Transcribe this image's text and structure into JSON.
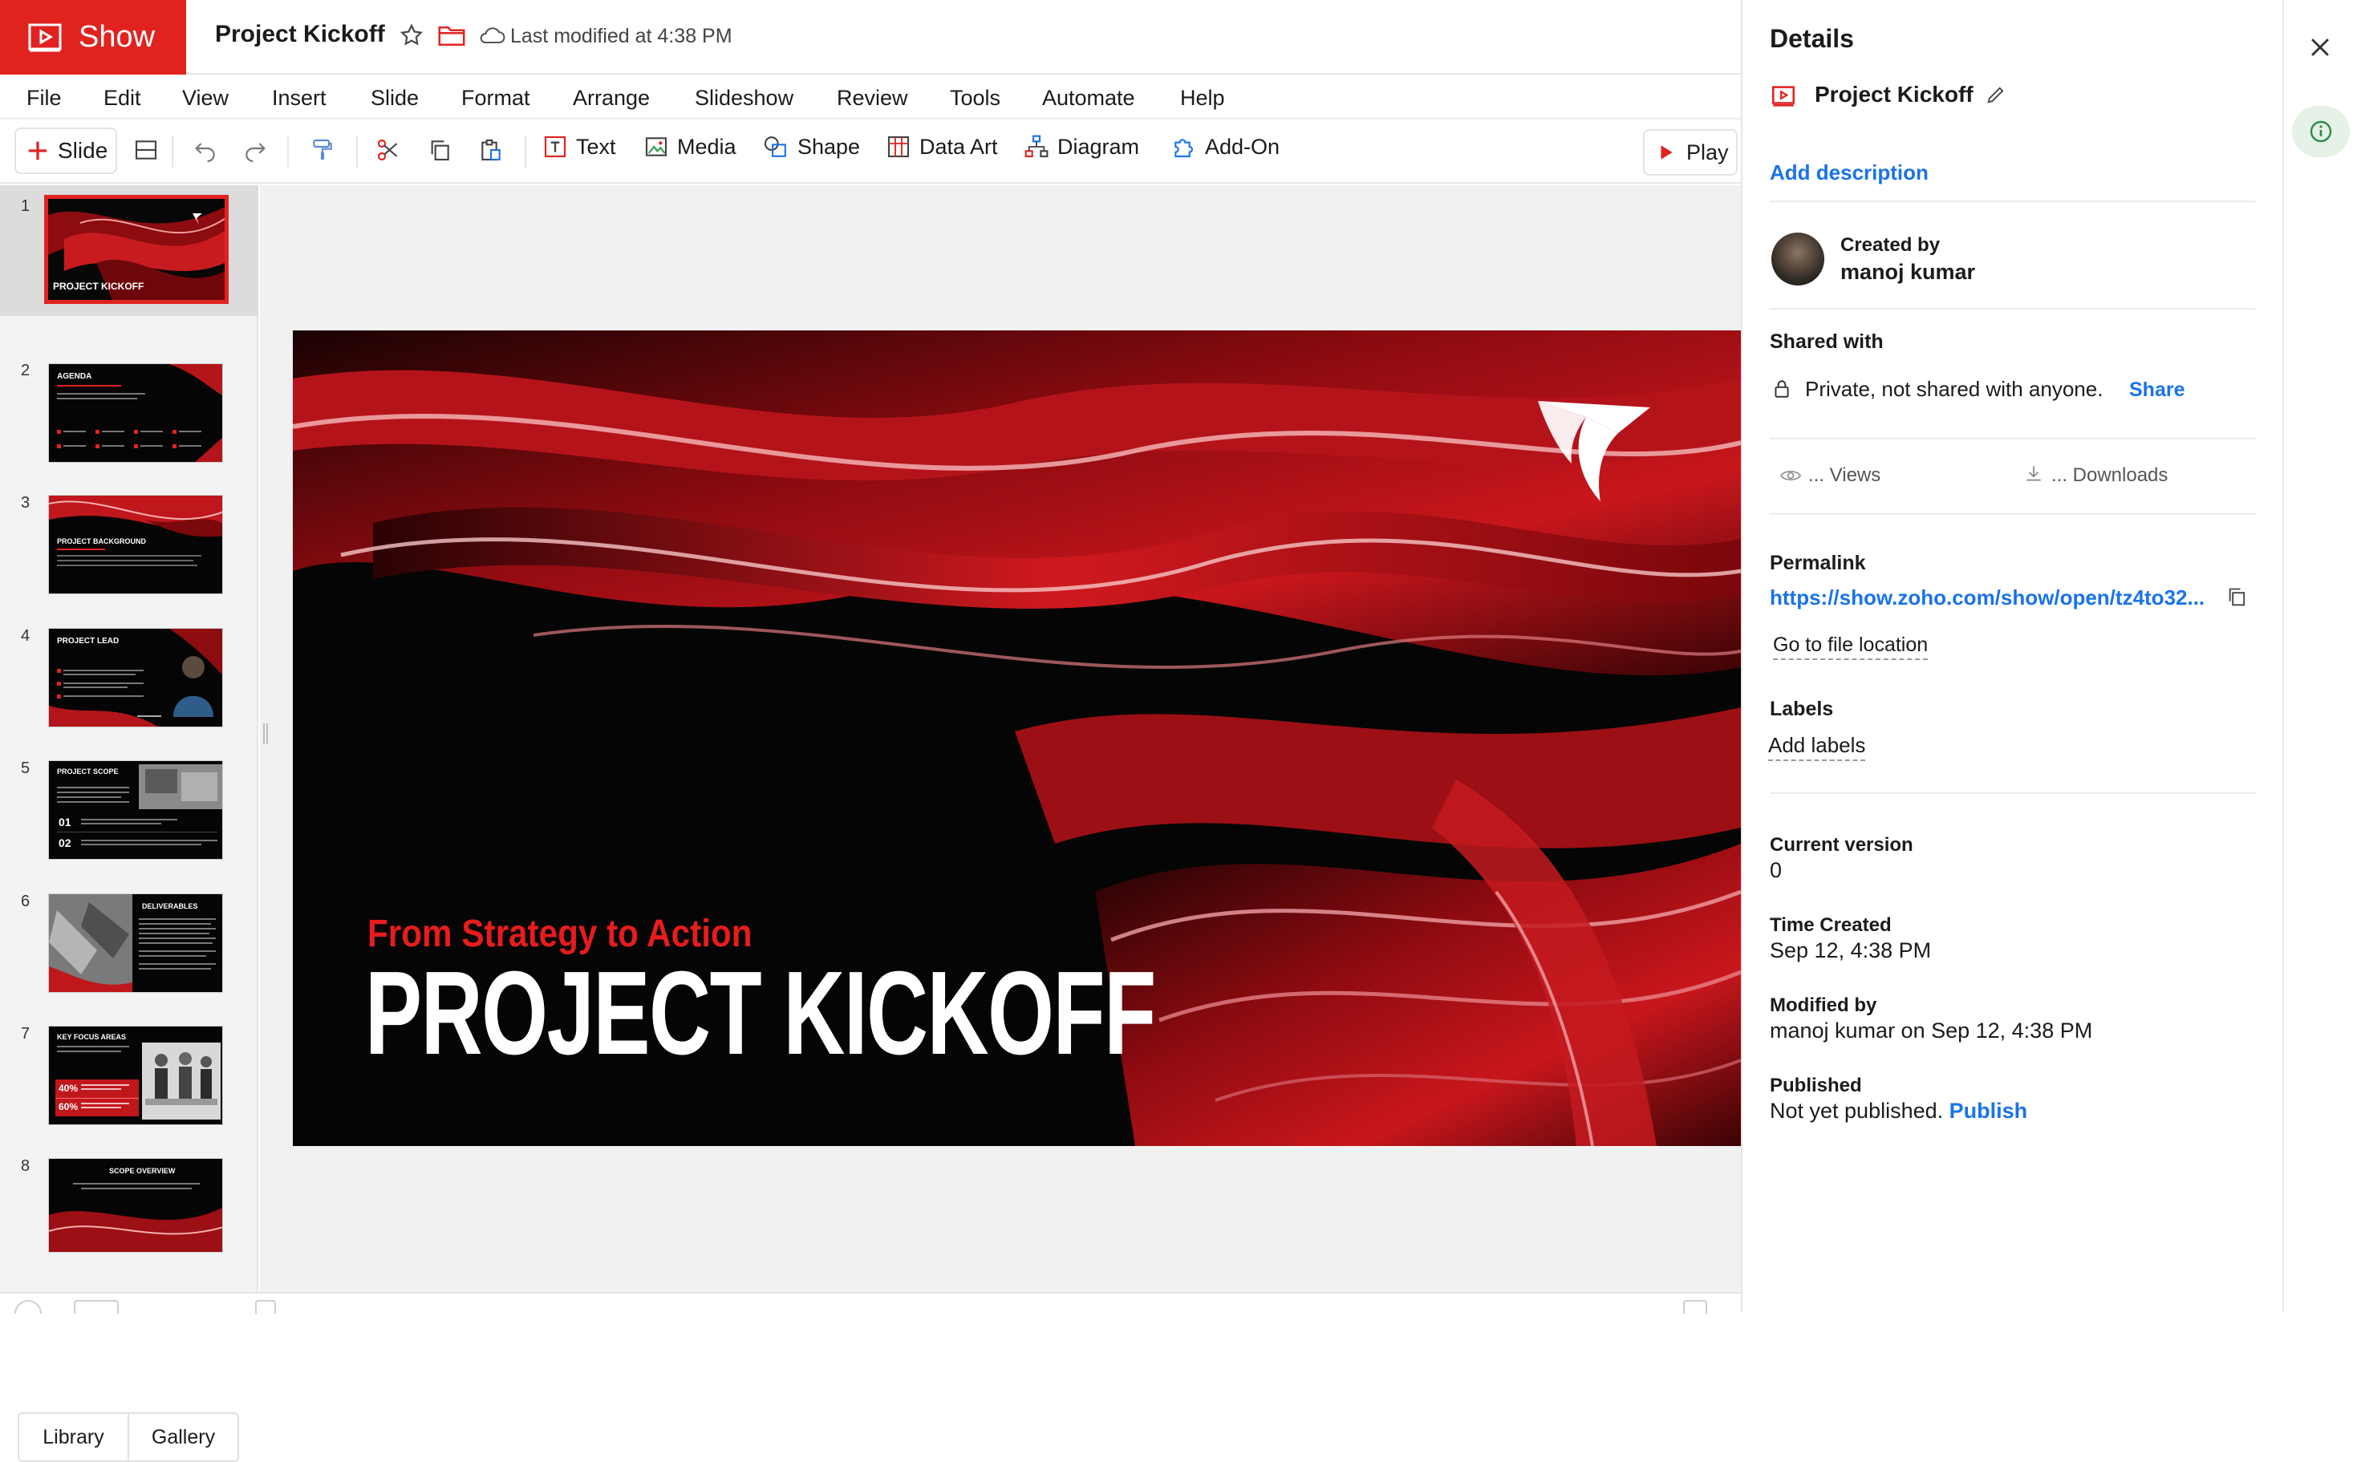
{
  "app": {
    "brand": "Show",
    "doc_title": "Project Kickoff",
    "last_modified": "Last modified at 4:38 PM"
  },
  "menu": [
    "File",
    "Edit",
    "View",
    "Insert",
    "Slide",
    "Format",
    "Arrange",
    "Slideshow",
    "Review",
    "Tools",
    "Automate",
    "Help"
  ],
  "toolbar": {
    "slide_label": "Slide",
    "text_label": "Text",
    "media_label": "Media",
    "shape_label": "Shape",
    "data_art_label": "Data Art",
    "diagram_label": "Diagram",
    "addon_label": "Add-On",
    "play_label": "Play"
  },
  "slides": [
    {
      "number": "1",
      "title": "PROJECT KICKOFF"
    },
    {
      "number": "2",
      "title": "AGENDA"
    },
    {
      "number": "3",
      "title": "PROJECT BACKGROUND"
    },
    {
      "number": "4",
      "title": "PROJECT LEAD"
    },
    {
      "number": "5",
      "title": "PROJECT SCOPE",
      "items": [
        "01",
        "02"
      ]
    },
    {
      "number": "6",
      "title": "DELIVERABLES"
    },
    {
      "number": "7",
      "title": "KEY FOCUS AREAS",
      "items": [
        "40%",
        "60%"
      ]
    },
    {
      "number": "8",
      "title": "SCOPE OVERVIEW"
    }
  ],
  "panel_tabs": {
    "library": "Library",
    "gallery": "Gallery"
  },
  "main_slide": {
    "subtitle": "From Strategy to Action",
    "title": "PROJECT KICKOFF"
  },
  "details": {
    "heading": "Details",
    "file_name": "Project Kickoff",
    "add_description": "Add description",
    "created_by_label": "Created by",
    "created_by": "manoj kumar",
    "shared_with_label": "Shared with",
    "shared_status": "Private, not shared with anyone.",
    "share_link": "Share",
    "views": "... Views",
    "downloads": "... Downloads",
    "permalink_label": "Permalink",
    "permalink": "https://show.zoho.com/show/open/tz4to32...",
    "go_to_location": "Go to file location",
    "labels_label": "Labels",
    "add_labels": "Add labels",
    "current_version_label": "Current version",
    "current_version": "0",
    "time_created_label": "Time Created",
    "time_created": "Sep 12, 4:38 PM",
    "modified_by_label": "Modified by",
    "modified_by": "manoj kumar on Sep 12, 4:38 PM",
    "published_label": "Published",
    "published_status": "Not yet published.",
    "publish_link": "Publish"
  },
  "colors": {
    "brand": "#e12320",
    "link": "#1a73e8",
    "slide_accent": "#e81c1c"
  },
  "icons": [
    "show-logo-icon",
    "star-icon",
    "folder-icon",
    "cloud-icon",
    "plus-icon",
    "layout-icon",
    "undo-icon",
    "redo-icon",
    "paint-format-icon",
    "cut-icon",
    "copy-icon",
    "paste-icon",
    "text-icon",
    "media-icon",
    "shape-icon",
    "data-art-icon",
    "diagram-icon",
    "addon-icon",
    "play-icon",
    "edit-icon",
    "lock-icon",
    "eye-icon",
    "download-icon",
    "close-icon",
    "info-icon"
  ]
}
